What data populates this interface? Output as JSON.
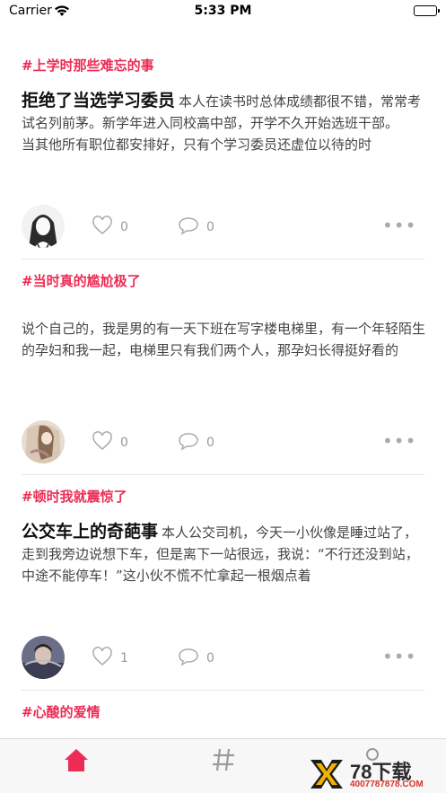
{
  "status_bar": {
    "carrier": "Carrier",
    "time": "5:33 PM"
  },
  "posts": [
    {
      "topic": "#上学时那些难忘的事",
      "title": "拒绝了当选学习委员",
      "excerpt": "本人在读书时总体成绩都很不错，常常考试名列前茅。新学年进入同校高中部，开学不久开始选班干部。\n当其他所有职位都安排好，只有个学习委员还虚位以待的时",
      "likes": "0",
      "comments": "0"
    },
    {
      "topic": "#当时真的尴尬极了",
      "title": "",
      "excerpt": " 说个自己的，我是男的有一天下班在写字楼电梯里，有一个年轻陌生的孕妇和我一起，电梯里只有我们两个人，那孕妇长得挺好看的",
      "likes": "0",
      "comments": "0"
    },
    {
      "topic": "#顿时我就震惊了",
      "title": "公交车上的奇葩事",
      "excerpt": "本人公交司机，今天一小伙像是睡过站了，走到我旁边说想下车，但是离下一站很远，我说：“不行还没到站，中途不能停车！”这小伙不慌不忙拿起一根烟点着",
      "likes": "1",
      "comments": "0"
    },
    {
      "topic": "#心酸的爱情"
    }
  ],
  "watermark": {
    "text": "78下载",
    "url": "4007787878.COM"
  },
  "colors": {
    "accent": "#ec2c55",
    "muted": "#999999"
  }
}
